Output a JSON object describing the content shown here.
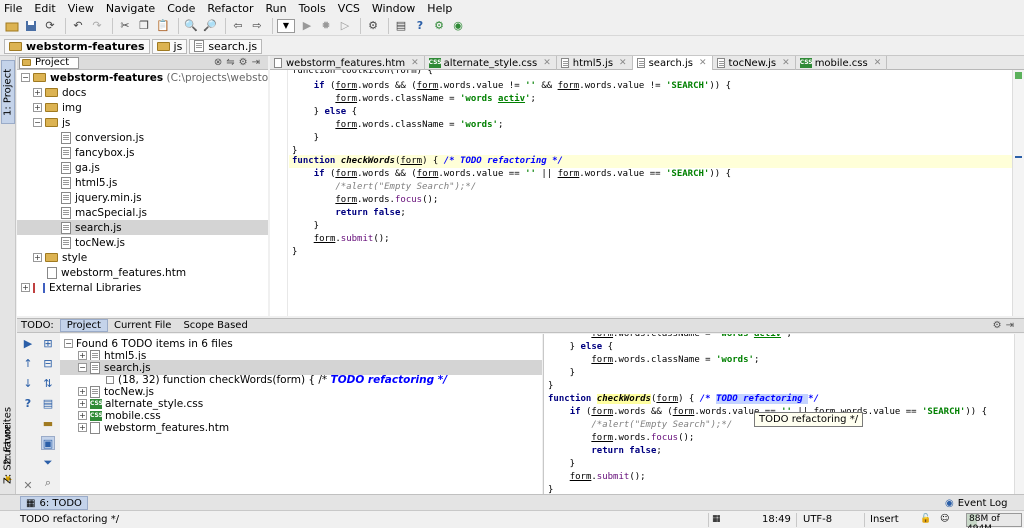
{
  "menu": [
    "File",
    "Edit",
    "View",
    "Navigate",
    "Code",
    "Refactor",
    "Run",
    "Tools",
    "VCS",
    "Window",
    "Help"
  ],
  "breadcrumb": {
    "project": "webstorm-features",
    "folder": "js",
    "file": "search.js"
  },
  "left_stripe": {
    "project_tab": "1: Project",
    "favorites_tab": "2: Favorites",
    "structure_tab": "Z: Structure"
  },
  "project_panel": {
    "selector": "Project",
    "root_name": "webstorm-features",
    "root_path": "(C:\\projects\\webstorm-features)",
    "items": [
      {
        "label": "docs"
      },
      {
        "label": "img"
      },
      {
        "label": "js"
      },
      {
        "label": "conversion.js"
      },
      {
        "label": "fancybox.js"
      },
      {
        "label": "ga.js"
      },
      {
        "label": "html5.js"
      },
      {
        "label": "jquery.min.js"
      },
      {
        "label": "macSpecial.js"
      },
      {
        "label": "search.js"
      },
      {
        "label": "tocNew.js"
      },
      {
        "label": "style"
      },
      {
        "label": "webstorm_features.htm"
      },
      {
        "label": "External Libraries"
      }
    ]
  },
  "editor_tabs": [
    "webstorm_features.htm",
    "alternate_style.css",
    "html5.js",
    "search.js",
    "tocNew.js",
    "mobile.css"
  ],
  "editor_lines": [
    "function toolkitOn(form) {",
    "    if (form.words && (form.words.value != '' && form.words.value != 'SEARCH')) {",
    "        form.words.className = 'words activ';",
    "    } else {",
    "        form.words.className = 'words';",
    "    }",
    "}",
    "function checkWords(form) { /* TODO refactoring */",
    "    if (form.words && (form.words.value == '' || form.words.value == 'SEARCH')) {",
    "        /*alert(\"Empty Search\");*/",
    "        form.words.focus();",
    "        return false;",
    "    }",
    "    form.submit();",
    "}"
  ],
  "todo_panel": {
    "title": "TODO:",
    "tabs": [
      "Project",
      "Current File",
      "Scope Based"
    ],
    "summary": "Found 6 TODO items in 6 files",
    "entries": [
      "html5.js",
      "search.js",
      "(18, 32) function checkWords(form) { /* TODO refactoring */",
      "tocNew.js",
      "alternate_style.css",
      "mobile.css",
      "webstorm_features.htm"
    ],
    "todo_location": "(18, 32)",
    "todo_code": "function checkWords(form) { /*",
    "todo_text": "TODO refactoring */"
  },
  "preview_lines": [
    "        form.words.className = 'words activ';",
    "    } else {",
    "        form.words.className = 'words';",
    "    }",
    "}",
    "function checkWords(form) { /* TODO refactoring */",
    "    if (form.words && (form.words.value == '' || form.words.value == 'SEARCH')) {",
    "        /*alert(\"Empty Search\");*/",
    "        form.words.focus();",
    "        return false;",
    "    }",
    "    form.submit();",
    "}"
  ],
  "tooltip": "TODO refactoring */",
  "bottom_strip": {
    "todo_tab": "6: TODO",
    "event_log": "Event Log"
  },
  "status": {
    "message": "TODO refactoring */",
    "position": "18:49",
    "encoding": "UTF-8",
    "mode": "Insert",
    "memory": "88M of 494M"
  },
  "colors": {
    "keyword": "#000080",
    "string": "#008000",
    "todo": "#0000ff",
    "comment": "#808080",
    "highlight": "#ffffd8",
    "selection": "#d4d4d4"
  }
}
